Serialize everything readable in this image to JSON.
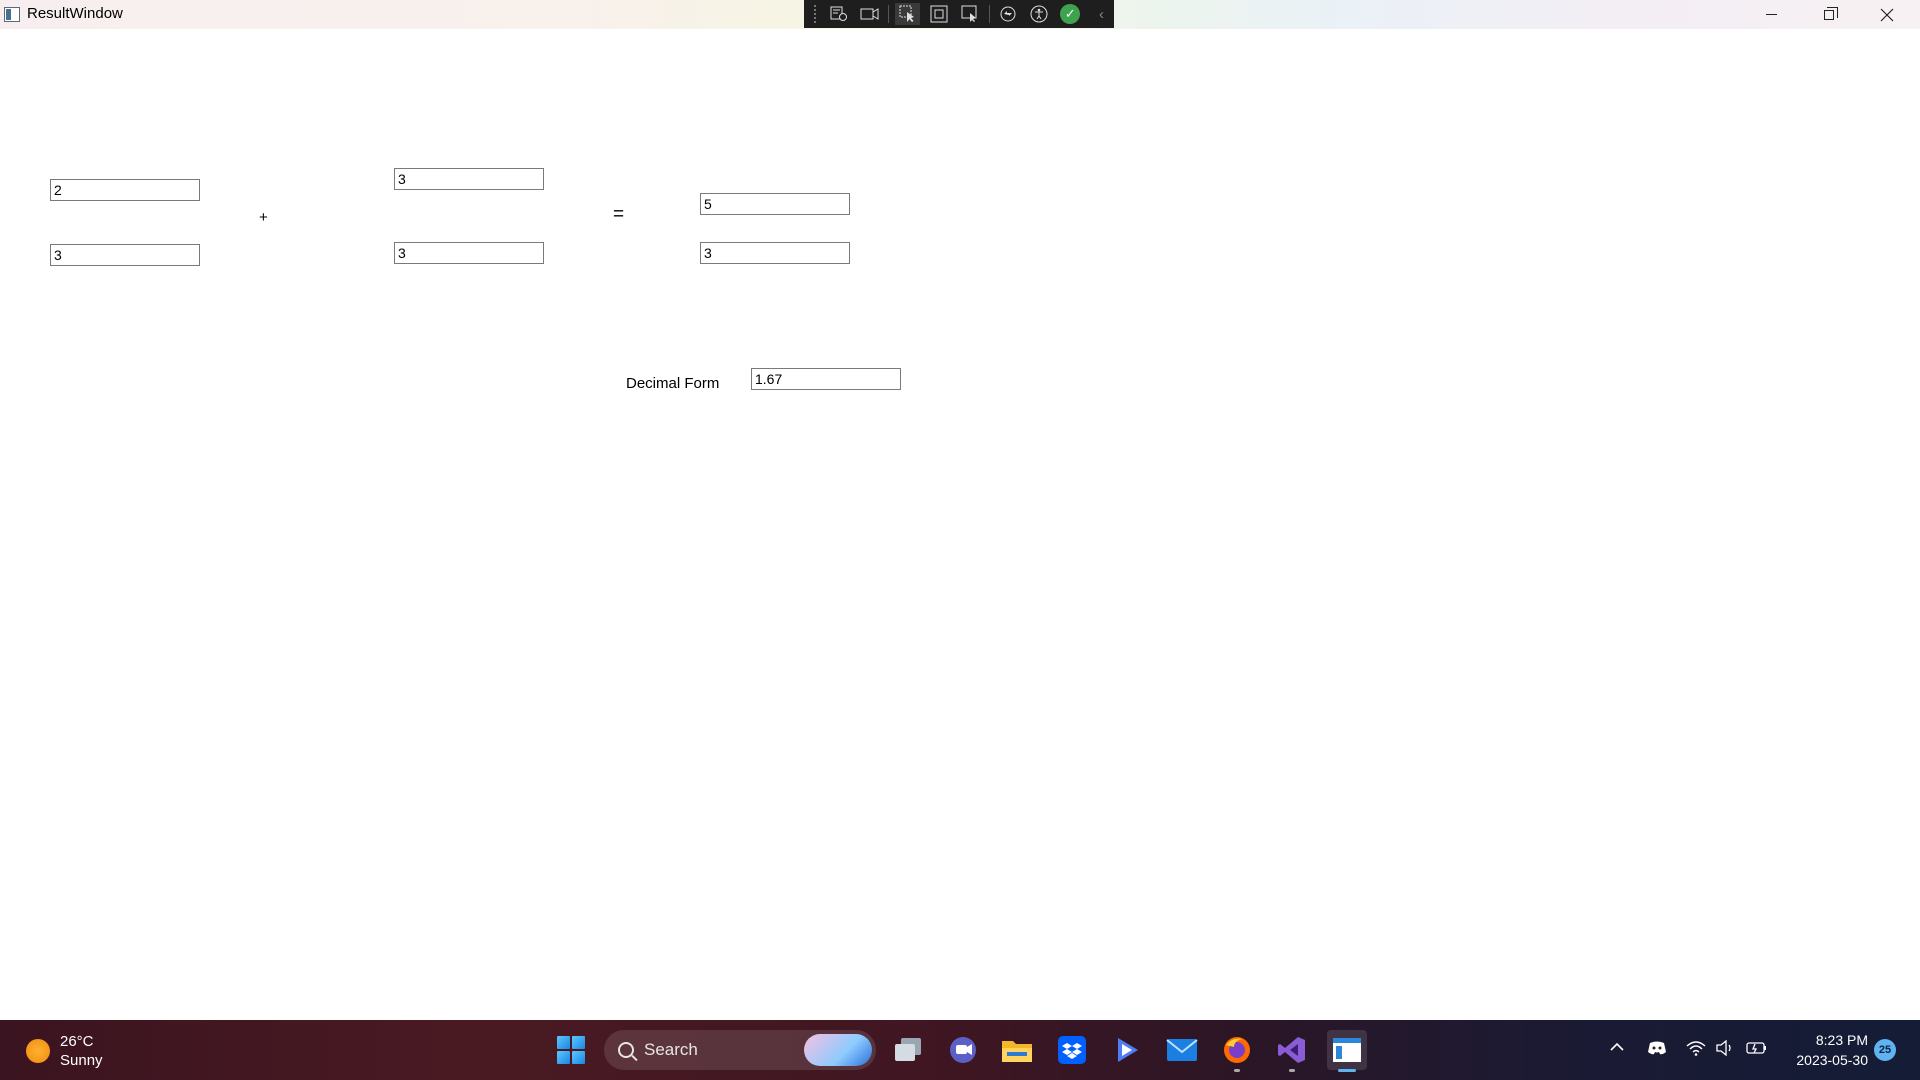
{
  "window": {
    "title": "ResultWindow"
  },
  "fraction1": {
    "numerator": "2",
    "denominator": "3"
  },
  "fraction2": {
    "numerator": "3",
    "denominator": "3"
  },
  "result": {
    "numerator": "5",
    "denominator": "3"
  },
  "operators": {
    "plus": "+",
    "equals": "="
  },
  "decimal": {
    "label": "Decimal Form",
    "value": "1.67"
  },
  "taskbar": {
    "weather": {
      "temp": "26°C",
      "condition": "Sunny"
    },
    "search_label": "Search",
    "time": "8:23 PM",
    "date": "2023-05-30",
    "notification_count": "25"
  }
}
